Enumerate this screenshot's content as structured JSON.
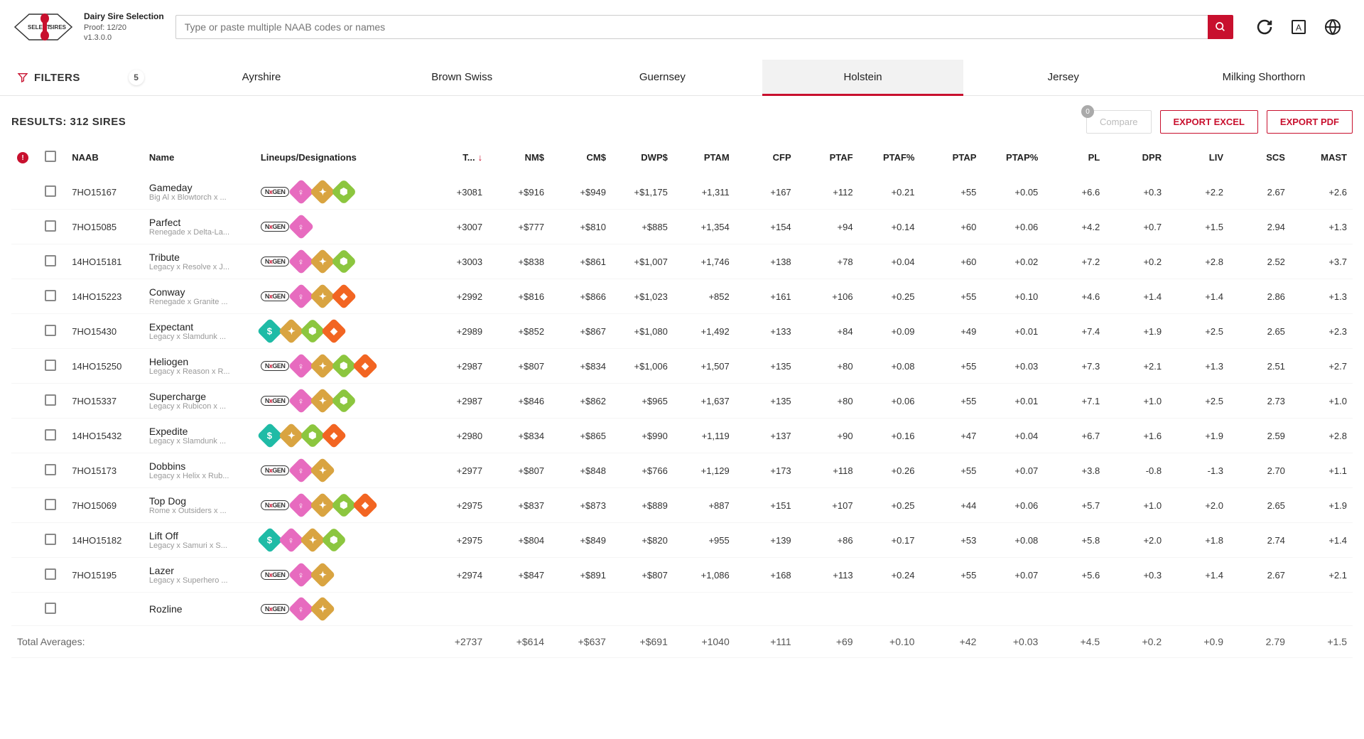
{
  "header": {
    "title": "Dairy Sire Selection",
    "proof": "Proof: 12/20",
    "version": "v1.3.0.0",
    "search_placeholder": "Type or paste multiple NAAB codes or names"
  },
  "tabs": {
    "filters_label": "FILTERS",
    "filter_count": "5",
    "breeds": [
      "Ayrshire",
      "Brown Swiss",
      "Guernsey",
      "Holstein",
      "Jersey",
      "Milking Shorthorn"
    ],
    "active_index": 3
  },
  "results": {
    "label": "RESULTS: 312 SIRES",
    "compare_label": "Compare",
    "compare_count": "0",
    "export_excel": "EXPORT EXCEL",
    "export_pdf": "EXPORT PDF"
  },
  "columns": [
    "NAAB",
    "Name",
    "Lineups/Designations",
    "T...",
    "NM$",
    "CM$",
    "DWP$",
    "PTAM",
    "CFP",
    "PTAF",
    "PTAF%",
    "PTAP",
    "PTAP%",
    "PL",
    "DPR",
    "LIV",
    "SCS",
    "MAST"
  ],
  "sorted_col_index": 3,
  "rows": [
    {
      "naab": "7HO15167",
      "name": "Gameday",
      "lineage": "Big Al x Blowtorch x ...",
      "nxgen": true,
      "badges": [
        "pink",
        "gold",
        "green"
      ],
      "vals": [
        "+3081",
        "+$916",
        "+$949",
        "+$1,175",
        "+1,311",
        "+167",
        "+112",
        "+0.21",
        "+55",
        "+0.05",
        "+6.6",
        "+0.3",
        "+2.2",
        "2.67",
        "+2.6"
      ]
    },
    {
      "naab": "7HO15085",
      "name": "Parfect",
      "lineage": "Renegade x Delta-La...",
      "nxgen": true,
      "badges": [
        "pink"
      ],
      "vals": [
        "+3007",
        "+$777",
        "+$810",
        "+$885",
        "+1,354",
        "+154",
        "+94",
        "+0.14",
        "+60",
        "+0.06",
        "+4.2",
        "+0.7",
        "+1.5",
        "2.94",
        "+1.3"
      ]
    },
    {
      "naab": "14HO15181",
      "name": "Tribute",
      "lineage": "Legacy x Resolve x J...",
      "nxgen": true,
      "badges": [
        "pink",
        "gold",
        "green"
      ],
      "vals": [
        "+3003",
        "+$838",
        "+$861",
        "+$1,007",
        "+1,746",
        "+138",
        "+78",
        "+0.04",
        "+60",
        "+0.02",
        "+7.2",
        "+0.2",
        "+2.8",
        "2.52",
        "+3.7"
      ]
    },
    {
      "naab": "14HO15223",
      "name": "Conway",
      "lineage": "Renegade x Granite ...",
      "nxgen": true,
      "badges": [
        "pink",
        "gold",
        "orange"
      ],
      "vals": [
        "+2992",
        "+$816",
        "+$866",
        "+$1,023",
        "+852",
        "+161",
        "+106",
        "+0.25",
        "+55",
        "+0.10",
        "+4.6",
        "+1.4",
        "+1.4",
        "2.86",
        "+1.3"
      ]
    },
    {
      "naab": "7HO15430",
      "name": "Expectant",
      "lineage": "Legacy x Slamdunk ...",
      "nxgen": false,
      "teal": true,
      "badges": [
        "gold",
        "green",
        "orange"
      ],
      "vals": [
        "+2989",
        "+$852",
        "+$867",
        "+$1,080",
        "+1,492",
        "+133",
        "+84",
        "+0.09",
        "+49",
        "+0.01",
        "+7.4",
        "+1.9",
        "+2.5",
        "2.65",
        "+2.3"
      ]
    },
    {
      "naab": "14HO15250",
      "name": "Heliogen",
      "lineage": "Legacy x Reason x R...",
      "nxgen": true,
      "badges": [
        "pink",
        "gold",
        "green",
        "orange"
      ],
      "vals": [
        "+2987",
        "+$807",
        "+$834",
        "+$1,006",
        "+1,507",
        "+135",
        "+80",
        "+0.08",
        "+55",
        "+0.03",
        "+7.3",
        "+2.1",
        "+1.3",
        "2.51",
        "+2.7"
      ]
    },
    {
      "naab": "7HO15337",
      "name": "Supercharge",
      "lineage": "Legacy x Rubicon x ...",
      "nxgen": true,
      "badges": [
        "pink",
        "gold",
        "green"
      ],
      "vals": [
        "+2987",
        "+$846",
        "+$862",
        "+$965",
        "+1,637",
        "+135",
        "+80",
        "+0.06",
        "+55",
        "+0.01",
        "+7.1",
        "+1.0",
        "+2.5",
        "2.73",
        "+1.0"
      ]
    },
    {
      "naab": "14HO15432",
      "name": "Expedite",
      "lineage": "Legacy x Slamdunk ...",
      "nxgen": false,
      "teal": true,
      "badges": [
        "gold",
        "green",
        "orange"
      ],
      "vals": [
        "+2980",
        "+$834",
        "+$865",
        "+$990",
        "+1,119",
        "+137",
        "+90",
        "+0.16",
        "+47",
        "+0.04",
        "+6.7",
        "+1.6",
        "+1.9",
        "2.59",
        "+2.8"
      ]
    },
    {
      "naab": "7HO15173",
      "name": "Dobbins",
      "lineage": "Legacy x Helix x Rub...",
      "nxgen": true,
      "badges": [
        "pink",
        "gold"
      ],
      "vals": [
        "+2977",
        "+$807",
        "+$848",
        "+$766",
        "+1,129",
        "+173",
        "+118",
        "+0.26",
        "+55",
        "+0.07",
        "+3.8",
        "-0.8",
        "-1.3",
        "2.70",
        "+1.1"
      ]
    },
    {
      "naab": "7HO15069",
      "name": "Top Dog",
      "lineage": "Rome x Outsiders x ...",
      "nxgen": true,
      "badges": [
        "pink",
        "gold",
        "green",
        "orange"
      ],
      "vals": [
        "+2975",
        "+$837",
        "+$873",
        "+$889",
        "+887",
        "+151",
        "+107",
        "+0.25",
        "+44",
        "+0.06",
        "+5.7",
        "+1.0",
        "+2.0",
        "2.65",
        "+1.9"
      ]
    },
    {
      "naab": "14HO15182",
      "name": "Lift Off",
      "lineage": "Legacy x Samuri x S...",
      "nxgen": false,
      "teal": true,
      "badges": [
        "pink",
        "gold",
        "green"
      ],
      "vals": [
        "+2975",
        "+$804",
        "+$849",
        "+$820",
        "+955",
        "+139",
        "+86",
        "+0.17",
        "+53",
        "+0.08",
        "+5.8",
        "+2.0",
        "+1.8",
        "2.74",
        "+1.4"
      ]
    },
    {
      "naab": "7HO15195",
      "name": "Lazer",
      "lineage": "Legacy x Superhero ...",
      "nxgen": true,
      "badges": [
        "pink",
        "gold"
      ],
      "vals": [
        "+2974",
        "+$847",
        "+$891",
        "+$807",
        "+1,086",
        "+168",
        "+113",
        "+0.24",
        "+55",
        "+0.07",
        "+5.6",
        "+0.3",
        "+1.4",
        "2.67",
        "+2.1"
      ]
    },
    {
      "naab": "",
      "name": "Rozline",
      "lineage": "",
      "nxgen": true,
      "badges": [
        "pink",
        "gold"
      ],
      "vals": [
        "",
        "",
        "",
        "",
        "",
        "",
        "",
        "",
        "",
        "",
        "",
        "",
        "",
        "",
        ""
      ]
    }
  ],
  "totals": {
    "label": "Total Averages:",
    "vals": [
      "+2737",
      "+$614",
      "+$637",
      "+$691",
      "+1040",
      "+111",
      "+69",
      "+0.10",
      "+42",
      "+0.03",
      "+4.5",
      "+0.2",
      "+0.9",
      "2.79",
      "+1.5"
    ]
  }
}
